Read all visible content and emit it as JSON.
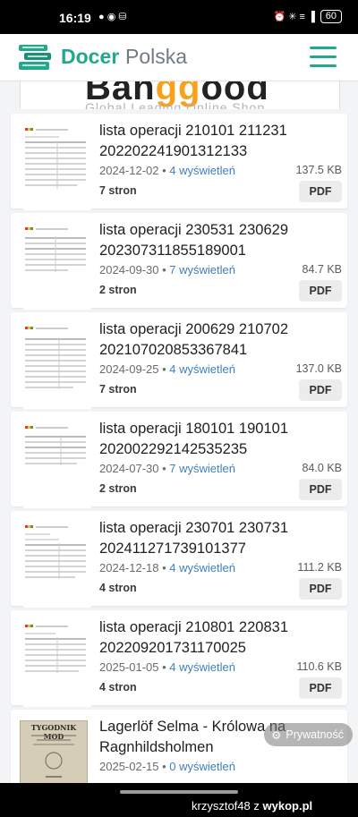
{
  "status": {
    "time": "16:19",
    "small_icons": "● ◉ ⛁",
    "right_icons": "⏰ ✳ ≡ ▐",
    "battery": "60"
  },
  "header": {
    "brand_primary": "Docer",
    "brand_secondary": "Polska",
    "accent_color": "#23a88e"
  },
  "ad": {
    "logo_pre": "Ban",
    "logo_mid": "gg",
    "logo_post": "ood",
    "tagline": "Global Leading Online Shop"
  },
  "documents": [
    {
      "title": "lista operacji 210101 211231 202202241901312133",
      "date": "2024-12-02",
      "views": "4 wyświetleń",
      "size": "137.5 KB",
      "pages": "7 stron",
      "format": "PDF"
    },
    {
      "title": "lista operacji 230531 230629 202307311855189001",
      "date": "2024-09-30",
      "views": "7 wyświetleń",
      "size": "84.7 KB",
      "pages": "2 stron",
      "format": "PDF"
    },
    {
      "title": "lista operacji 200629 210702 202107020853367841",
      "date": "2024-09-25",
      "views": "4 wyświetleń",
      "size": "137.0 KB",
      "pages": "7 stron",
      "format": "PDF"
    },
    {
      "title": "lista operacji 180101 190101 202002292142535235",
      "date": "2024-07-30",
      "views": "7 wyświetleń",
      "size": "84.0 KB",
      "pages": "2 stron",
      "format": "PDF"
    },
    {
      "title": "lista operacji 230701 230731 202411271739101377",
      "date": "2024-12-18",
      "views": "4 wyświetleń",
      "size": "111.2 KB",
      "pages": "4 stron",
      "format": "PDF"
    },
    {
      "title": "lista operacji 210801 220831 202209201731170025",
      "date": "2025-01-05",
      "views": "4 wyświetleń",
      "size": "110.6 KB",
      "pages": "4 stron",
      "format": "PDF"
    },
    {
      "title": "Lagerlöf Selma - Królowa na Ragnhildsholmen",
      "date": "2025-02-15",
      "views": "0 wyświetleń",
      "size": "",
      "pages": "",
      "format": "",
      "thumb_title": "TYGODNIK MOD"
    }
  ],
  "privacy_label": "Prywatność",
  "credit": {
    "author": "krzysztof48",
    "sep": "z",
    "site": "wykop.pl"
  }
}
